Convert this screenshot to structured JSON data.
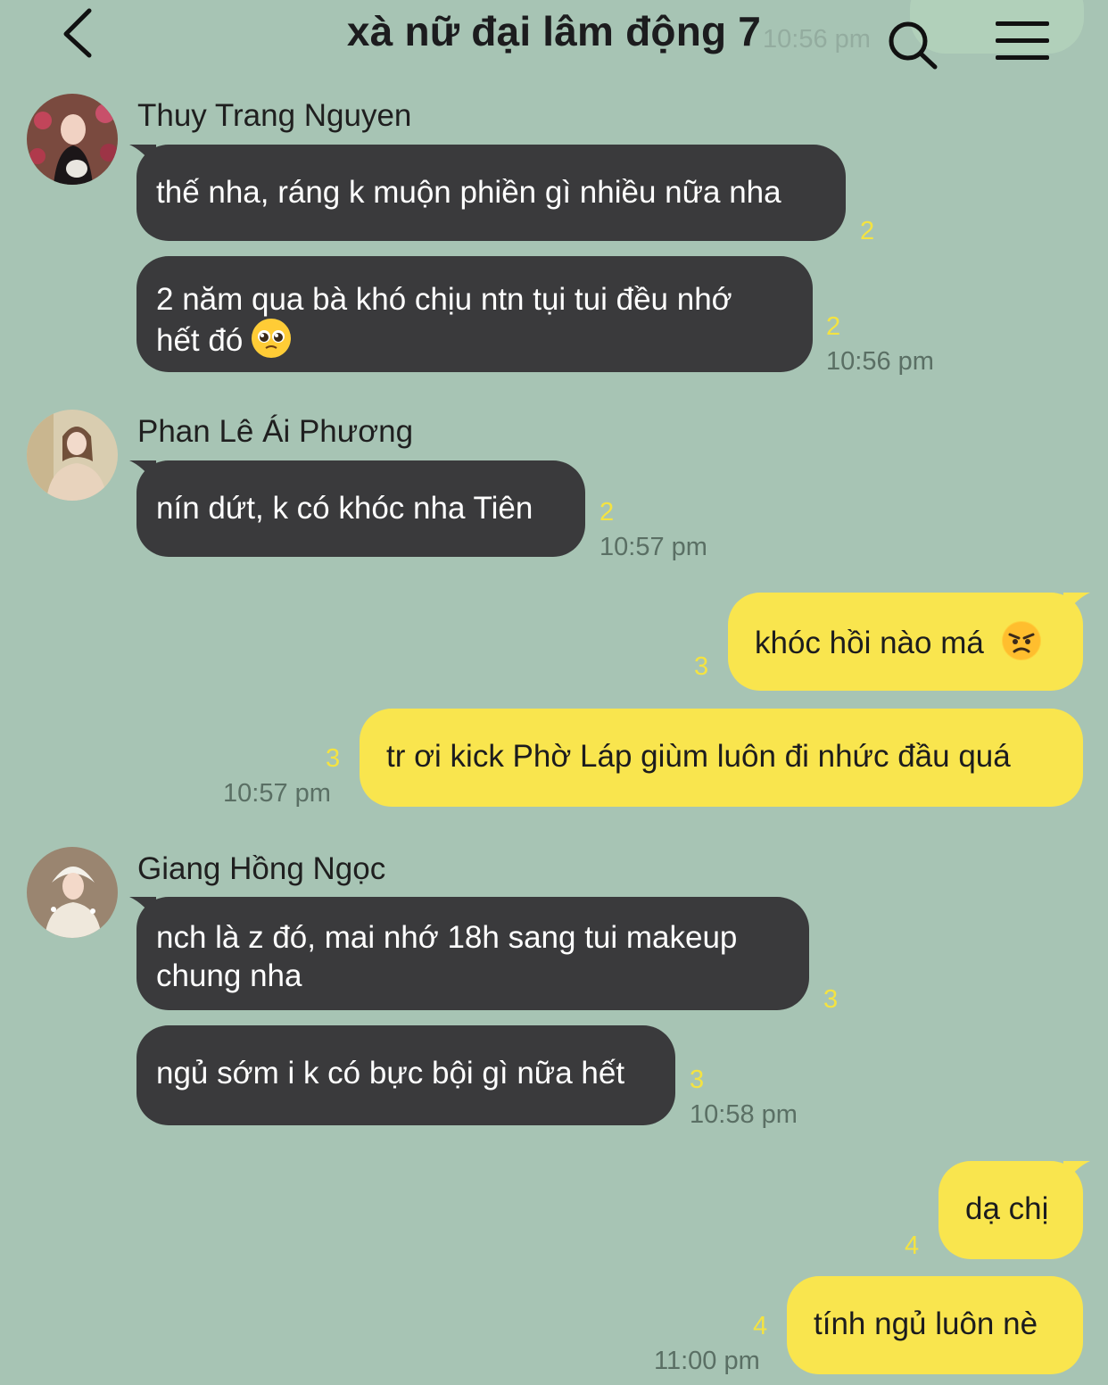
{
  "header": {
    "title": "xà nữ đại lâm động 7",
    "ghost_time": "10:56 pm"
  },
  "messages": [
    {
      "sender": "Thuy Trang Nguyen",
      "text": "thế nha, ráng k muộn phiền gì nhiều nữa nha",
      "read": "2"
    },
    {
      "text_line1": "2 năm qua bà khó chịu ntn tụi tui đều nhớ",
      "text_line2": "hết đó",
      "emoji": "pleading-face",
      "read": "2",
      "time": "10:56 pm"
    },
    {
      "sender": "Phan Lê Ái Phương",
      "text": "nín dứt, k có khóc nha Tiên",
      "read": "2",
      "time": "10:57 pm"
    },
    {
      "text": "khóc hồi nào má",
      "emoji": "angry-face",
      "read": "3"
    },
    {
      "text": "tr ơi kick Phờ Láp giùm luôn đi nhức đầu quá",
      "read": "3",
      "time": "10:57 pm"
    },
    {
      "sender": "Giang Hồng Ngọc",
      "text_line1": "nch là z đó, mai nhớ 18h sang tui makeup",
      "text_line2": "chung nha",
      "read": "3"
    },
    {
      "text": "ngủ sớm i k có bực bội gì nữa hết",
      "read": "3",
      "time": "10:58 pm"
    },
    {
      "text": "dạ chị",
      "read": "4"
    },
    {
      "text": "tính ngủ luôn nè",
      "read": "4",
      "time": "11:00 pm"
    }
  ]
}
